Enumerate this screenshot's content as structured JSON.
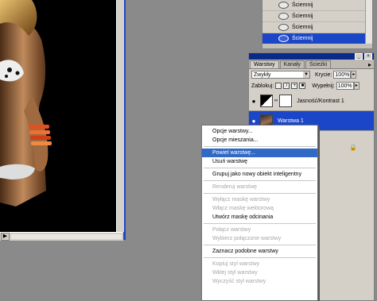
{
  "history": {
    "items": [
      {
        "label": "Ściemnij",
        "selected": false
      },
      {
        "label": "Ściemnij",
        "selected": false
      },
      {
        "label": "Ściemnij",
        "selected": false
      },
      {
        "label": "Ściemnij",
        "selected": true
      }
    ]
  },
  "layers_panel": {
    "tabs": [
      "Warstwy",
      "Kanały",
      "Ścieżki"
    ],
    "blend_mode": "Zwykły",
    "opacity_label": "Krycie:",
    "opacity_value": "100%",
    "lock_label": "Zablokuj:",
    "fill_label": "Wypełnij:",
    "fill_value": "100%",
    "layers": [
      {
        "name": "Jasność/Kontrast 1",
        "selected": false
      },
      {
        "name": "Warstwa 1",
        "selected": true
      }
    ]
  },
  "context_menu": {
    "items": [
      {
        "label": "Opcje warstwy...",
        "enabled": true
      },
      {
        "label": "Opcje mieszania...",
        "enabled": true
      },
      {
        "separator": true
      },
      {
        "label": "Powiel warstwę...",
        "enabled": true,
        "highlighted": true
      },
      {
        "label": "Usuń warstwę",
        "enabled": true
      },
      {
        "separator": true
      },
      {
        "label": "Grupuj jako nowy obiekt inteligentny",
        "enabled": true
      },
      {
        "separator": true
      },
      {
        "label": "Renderuj warstwę",
        "enabled": false
      },
      {
        "separator": true
      },
      {
        "label": "Wyłącz maskę warstwy",
        "enabled": false
      },
      {
        "label": "Włącz maskę wektorową",
        "enabled": false
      },
      {
        "label": "Utwórz maskę odcinania",
        "enabled": true
      },
      {
        "separator": true
      },
      {
        "label": "Połącz warstwy",
        "enabled": false
      },
      {
        "label": "Wybierz połączone warstwy",
        "enabled": false
      },
      {
        "separator": true
      },
      {
        "label": "Zaznacz podobne warstwy",
        "enabled": true
      },
      {
        "separator": true
      },
      {
        "label": "Kopiuj styl warstwy",
        "enabled": false
      },
      {
        "label": "Wklej styl warstwy",
        "enabled": false
      },
      {
        "label": "Wyczyść styl warstwy",
        "enabled": false
      }
    ]
  }
}
